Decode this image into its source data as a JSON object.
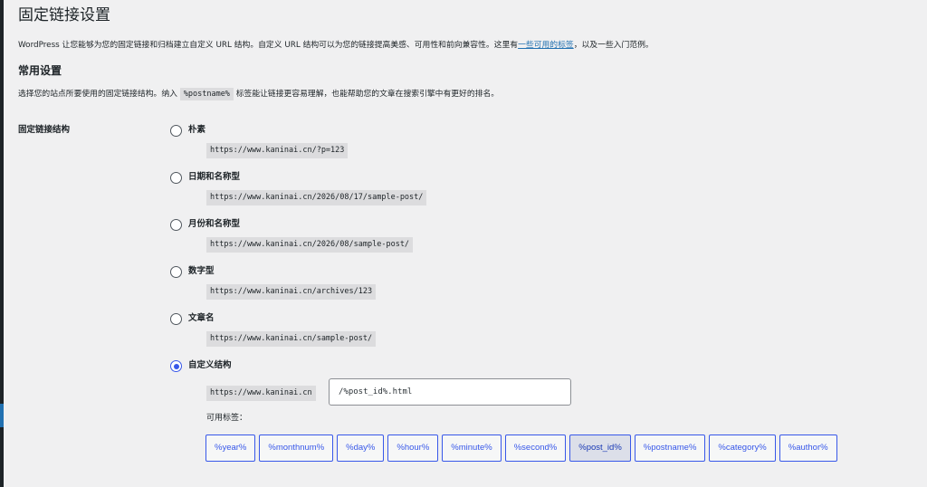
{
  "page": {
    "title": "固定链接设置",
    "intro_before": "WordPress 让您能够为您的固定链接和归档建立自定义 URL 结构。自定义 URL 结构可以为您的链接提高美感、可用性和前向兼容性。这里有",
    "intro_link": "一些可用的标签",
    "intro_after": "，以及一些入门范例。"
  },
  "common": {
    "heading": "常用设置",
    "desc_before": "选择您的站点所要使用的固定链接结构。纳入",
    "desc_code": "%postname%",
    "desc_after": "标签能让链接更容易理解，也能帮助您的文章在搜索引擎中有更好的排名。"
  },
  "structure": {
    "label": "固定链接结构",
    "options": [
      {
        "label": "朴素",
        "url": "https://www.kaninai.cn/?p=123",
        "checked": false
      },
      {
        "label": "日期和名称型",
        "url": "https://www.kaninai.cn/2026/08/17/sample-post/",
        "checked": false
      },
      {
        "label": "月份和名称型",
        "url": "https://www.kaninai.cn/2026/08/sample-post/",
        "checked": false
      },
      {
        "label": "数字型",
        "url": "https://www.kaninai.cn/archives/123",
        "checked": false
      },
      {
        "label": "文章名",
        "url": "https://www.kaninai.cn/sample-post/",
        "checked": false
      }
    ],
    "custom": {
      "label": "自定义结构",
      "checked": true,
      "prefix": "https://www.kaninai.cn",
      "value": "/%post_id%.html"
    },
    "tags_label": "可用标签：",
    "tags": [
      {
        "label": "%year%",
        "active": false
      },
      {
        "label": "%monthnum%",
        "active": false
      },
      {
        "label": "%day%",
        "active": false
      },
      {
        "label": "%hour%",
        "active": false
      },
      {
        "label": "%minute%",
        "active": false
      },
      {
        "label": "%second%",
        "active": false
      },
      {
        "label": "%post_id%",
        "active": true
      },
      {
        "label": "%postname%",
        "active": false
      },
      {
        "label": "%category%",
        "active": false
      },
      {
        "label": "%author%",
        "active": false
      }
    ]
  },
  "colors": {
    "accent": "#3858e9",
    "link": "#2271b1",
    "background": "#f0f0f1",
    "code_bg": "#dcdcde"
  }
}
